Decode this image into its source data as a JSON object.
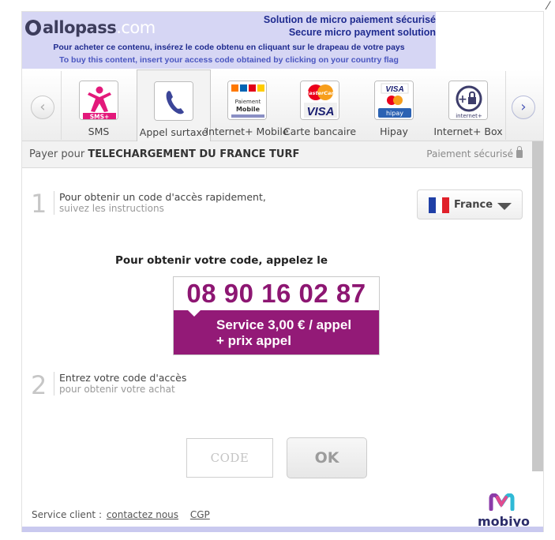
{
  "header": {
    "logo_part1": "allopass",
    "logo_part2": ".com",
    "slogan_fr": "Solution de micro paiement sécurisé",
    "slogan_en": "Secure micro payment solution",
    "instruction_fr": "Pour acheter ce contenu, insérez le code obtenu en cliquant sur le drapeau de votre pays",
    "instruction_en": "To buy this content, insert your access code obtained by clicking on your country flag",
    "color": "#d6d6f4"
  },
  "tabs": [
    {
      "label": "SMS",
      "icon": "sms-plus-icon",
      "icon_text": "SMS+"
    },
    {
      "label": "Appel surtaxé",
      "icon": "phone-handset-icon",
      "active": true
    },
    {
      "label": "Internet+ Mobile",
      "icon": "internet-mobile-icon",
      "icon_text": "Paiement Mobile"
    },
    {
      "label": "Carte bancaire",
      "icon": "credit-card-icon",
      "icon_text": "MasterCard VISA"
    },
    {
      "label": "Hipay",
      "icon": "hipay-icon",
      "icon_text": "VISA hipay"
    },
    {
      "label": "Internet+ Box",
      "icon": "internet-box-icon",
      "icon_text": "internet+"
    }
  ],
  "pay_bar": {
    "prefix": "Payer pour",
    "title": "TELECHARGEMENT DU FRANCE TURF",
    "secure_label": "Paiement sécurisé"
  },
  "step1": {
    "number": "1",
    "main": "Pour obtenir un code d'accès rapidement,",
    "sub": "suivez les instructions"
  },
  "country": {
    "selected": "France",
    "flag_colors": [
      "#1f3fa6",
      "#ffffff",
      "#e0202a"
    ]
  },
  "call": {
    "text": "Pour obtenir votre code, appelez le",
    "phone": "08 90 16 02 87",
    "price_line1": "Service 3,00 € / appel",
    "price_line2": "+ prix appel",
    "accent": "#931a77"
  },
  "step2": {
    "number": "2",
    "main": "Entrez votre code d'accès",
    "sub": "pour obtenir votre achat"
  },
  "code_form": {
    "placeholder": "CODE",
    "value": "",
    "ok_label": "OK"
  },
  "footer": {
    "service_label": "Service client :",
    "contact_link": "contactez nous",
    "cgp_link": "CGP"
  },
  "brand": {
    "name": "mobiyo"
  }
}
